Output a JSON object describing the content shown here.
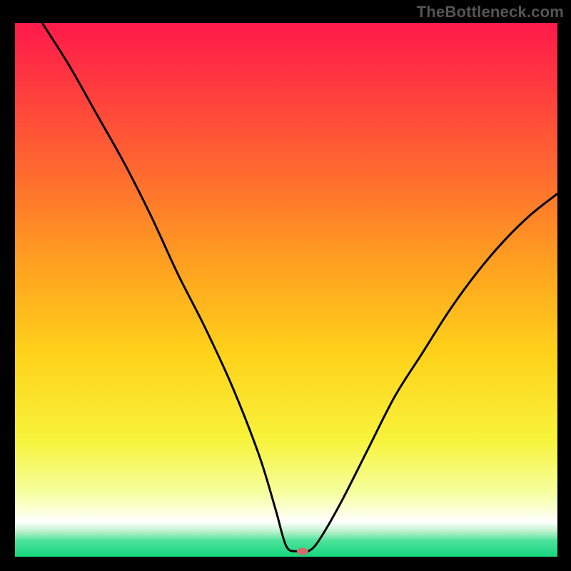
{
  "attribution": "TheBottleneck.com",
  "chart_data": {
    "type": "line",
    "title": "",
    "xlabel": "",
    "ylabel": "",
    "xlim": [
      0,
      100
    ],
    "ylim": [
      0,
      100
    ],
    "grid": false,
    "note": "No axis ticks or numeric labels are rendered in the image; x/y values are normalized 0-100 estimates read from geometry.",
    "background_gradient": {
      "stops": [
        {
          "pos": 0.0,
          "color": "#ff1a4b"
        },
        {
          "pos": 0.12,
          "color": "#ff3b3f"
        },
        {
          "pos": 0.28,
          "color": "#ff6a2f"
        },
        {
          "pos": 0.45,
          "color": "#ffa020"
        },
        {
          "pos": 0.62,
          "color": "#ffd21a"
        },
        {
          "pos": 0.78,
          "color": "#f7f33a"
        },
        {
          "pos": 0.88,
          "color": "#f6ff9f"
        },
        {
          "pos": 0.935,
          "color": "#ffffff"
        },
        {
          "pos": 0.952,
          "color": "#bff2ce"
        },
        {
          "pos": 0.97,
          "color": "#4be39a"
        },
        {
          "pos": 1.0,
          "color": "#16d67d"
        }
      ]
    },
    "series": [
      {
        "name": "bottleneck-curve",
        "color": "#000000",
        "x": [
          5,
          10,
          15,
          20,
          25,
          30,
          35,
          40,
          45,
          48,
          50,
          52,
          54,
          56,
          60,
          65,
          70,
          75,
          80,
          85,
          90,
          95,
          100
        ],
        "y": [
          100,
          92,
          83,
          74,
          64,
          53,
          43,
          32,
          19,
          9,
          2,
          1,
          1,
          3,
          10,
          20,
          30,
          38,
          46,
          53,
          59,
          64,
          68
        ]
      }
    ],
    "marker": {
      "name": "optimal-point",
      "x": 53,
      "y": 1,
      "color": "#d46a6a",
      "rx": 8,
      "ry": 5
    }
  }
}
